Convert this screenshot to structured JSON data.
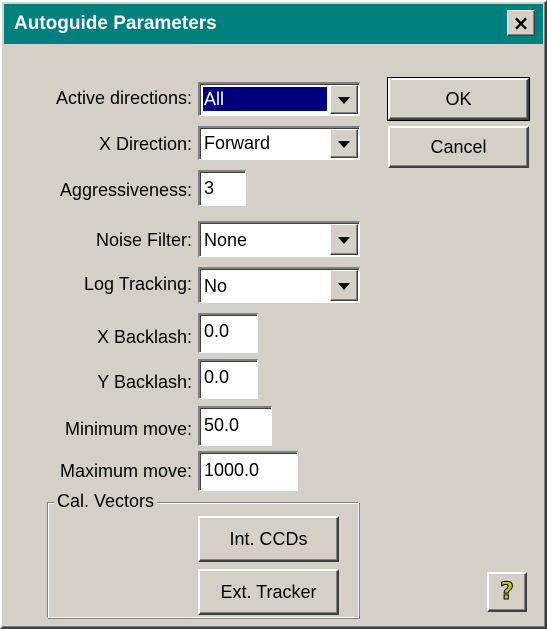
{
  "window": {
    "title": "Autoguide Parameters",
    "close_glyph": "×",
    "title_bar_color": "#007f7f",
    "face_color": "#d4d0c8"
  },
  "fields": {
    "active_directions": {
      "label": "Active directions:",
      "value": "All"
    },
    "x_direction": {
      "label": "X Direction:",
      "value": "Forward"
    },
    "aggressiveness": {
      "label": "Aggressiveness:",
      "value": "3"
    },
    "noise_filter": {
      "label": "Noise Filter:",
      "value": "None"
    },
    "log_tracking": {
      "label": "Log Tracking:",
      "value": "No"
    },
    "x_backlash": {
      "label": "X Backlash:",
      "value": "0.0"
    },
    "y_backlash": {
      "label": "Y Backlash:",
      "value": "0.0"
    },
    "minimum_move": {
      "label": "Minimum move:",
      "value": "50.0"
    },
    "maximum_move": {
      "label": "Maximum move:",
      "value": "1000.0"
    }
  },
  "cal_vectors": {
    "group_label": "Cal. Vectors",
    "int_ccds_label": "Int. CCDs",
    "ext_tracker_label": "Ext. Tracker"
  },
  "buttons": {
    "ok_label": "OK",
    "cancel_label": "Cancel",
    "help_glyph": "?",
    "help_icon": "help-question-icon"
  }
}
